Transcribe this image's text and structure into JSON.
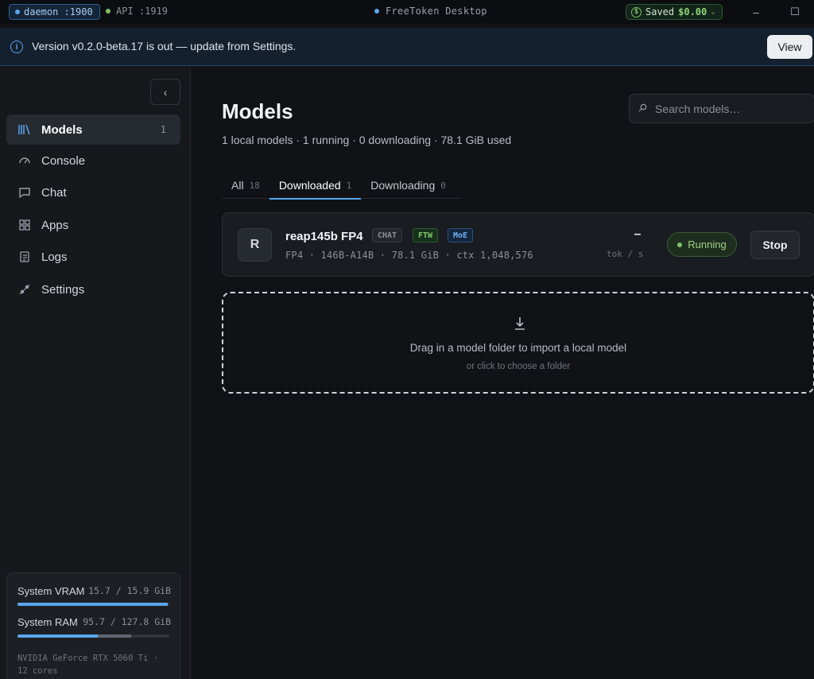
{
  "titlebar": {
    "daemon": "daemon :1900",
    "api": "API :1919",
    "app_title": "FreeToken Desktop",
    "saved_label": "Saved",
    "saved_amount": "$0.00",
    "minimize": "–",
    "maximize": "☐"
  },
  "banner": {
    "message": "Version v0.2.0-beta.17 is out — update from Settings.",
    "view_label": "View"
  },
  "sidebar": {
    "items": [
      {
        "label": "Models",
        "count": "1"
      },
      {
        "label": "Console"
      },
      {
        "label": "Chat"
      },
      {
        "label": "Apps"
      },
      {
        "label": "Logs"
      },
      {
        "label": "Settings"
      }
    ],
    "system": {
      "vram_label": "System VRAM",
      "vram_value": "15.7 / 15.9 GiB",
      "vram_fraction": 0.987,
      "ram_label": "System RAM",
      "ram_value": "95.7 / 127.8 GiB",
      "ram_fraction": 0.53,
      "ram_extra_fraction": 0.22,
      "gpu": "NVIDIA GeForce RTX 5060 Ti · 12 cores"
    }
  },
  "main": {
    "title": "Models",
    "subtitle": "1 local models · 1 running · 0 downloading · 78.1 GiB used",
    "search_placeholder": "Search models…",
    "tabs": [
      {
        "label": "All",
        "count": "18"
      },
      {
        "label": "Downloaded",
        "count": "1"
      },
      {
        "label": "Downloading",
        "count": "0"
      }
    ],
    "model": {
      "initial": "R",
      "name": "reap145b FP4",
      "tags": [
        "CHAT",
        "FTW",
        "MoE"
      ],
      "meta": "FP4 · 146B-A14B · 78.1 GiB · ctx 1,048,576",
      "tok_value": "–",
      "tok_unit": "tok / s",
      "status": "Running",
      "stop_label": "Stop"
    },
    "dropzone": {
      "title": "Drag in a model folder to import a local model",
      "subtitle": "or click to choose a folder"
    }
  },
  "colors": {
    "accent": "#5aa6ee",
    "running": "#9fd38a",
    "background": "#101216"
  }
}
